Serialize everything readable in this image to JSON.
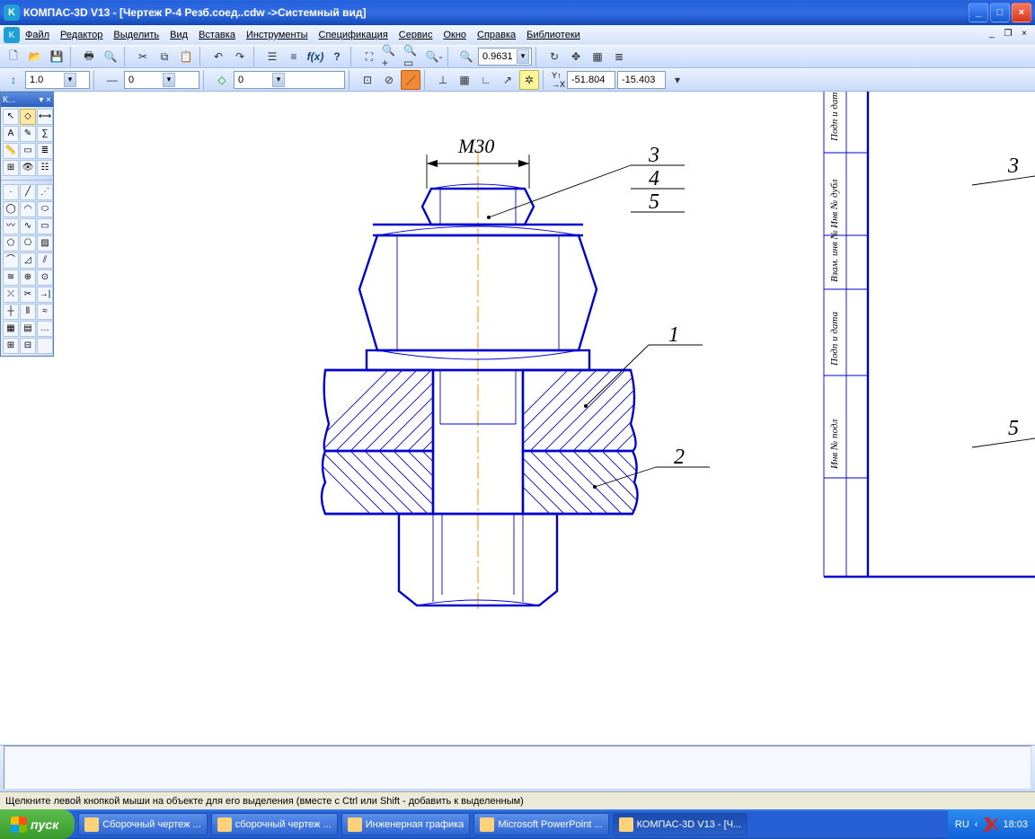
{
  "title": "КОМПАС-3D V13 - [Чертеж Р-4 Резб.соед..cdw ->Системный вид]",
  "menu": {
    "file": "Файл",
    "edit": "Редактор",
    "select": "Выделить",
    "view": "Вид",
    "insert": "Вставка",
    "tools": "Инструменты",
    "spec": "Спецификация",
    "service": "Сервис",
    "window": "Окно",
    "help": "Справка",
    "libs": "Библиотеки"
  },
  "toolbar1": {
    "zoom": "0.9631"
  },
  "toolbar2": {
    "lineweight": "1.0",
    "step": "0",
    "layer": "0",
    "xlbl": "X",
    "ylbl": "Y",
    "coord_x": "-51.804",
    "coord_y": "-15.403"
  },
  "vbox_title": "К...",
  "status": "Щелкните левой кнопкой мыши на объекте для его выделения (вместе с Ctrl или Shift - добавить к выделенным)",
  "drawing": {
    "dim": "M30",
    "p1": "1",
    "p2": "2",
    "p3": "3",
    "p4": "4",
    "p5": "5",
    "r_p3": "3",
    "r_p5": "5"
  },
  "frame_labels": [
    "Подп и дата",
    "Инв № дубл",
    "Взам. инв №",
    "Подп и дата",
    "Инв № подл"
  ],
  "start": "пуск",
  "tasks": [
    {
      "label": "Сборочный чертеж ...",
      "cls": ""
    },
    {
      "label": "сборочный чертеж ...",
      "cls": ""
    },
    {
      "label": "Инженерная графика",
      "cls": ""
    },
    {
      "label": "Microsoft PowerPoint ...",
      "cls": ""
    },
    {
      "label": "КОМПАС-3D V13 - [Ч...",
      "cls": "active"
    }
  ],
  "lang": "RU",
  "clock": "18:03"
}
